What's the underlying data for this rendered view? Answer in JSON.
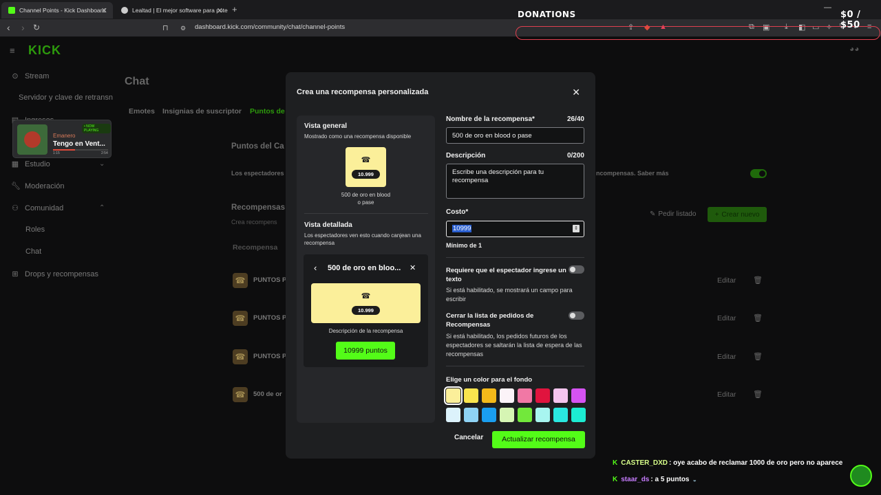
{
  "browser": {
    "tabs": [
      {
        "title": "Channel Points - Kick Dashboard",
        "active": true
      },
      {
        "title": "Lealtad | El mejor software para pote"
      }
    ],
    "new_tab": "+",
    "url": "dashboard.kick.com/community/chat/channel-points",
    "window_controls": [
      "—",
      "□",
      "✕"
    ]
  },
  "stream_overlay": {
    "donations_label": "DONATIONS",
    "donation_progress": "$0 / $50"
  },
  "sidebar": {
    "logo": "KICK",
    "items": [
      {
        "label": "Stream",
        "icon": "stream-icon"
      },
      {
        "label": "Servidor y clave de retransn"
      },
      {
        "label": "Ingresos",
        "icon": "income-icon"
      },
      {
        "label": "Estudio",
        "icon": "studio-icon"
      },
      {
        "label": "Moderación",
        "icon": "wrench-icon"
      },
      {
        "label": "Comunidad",
        "icon": "community-icon"
      },
      {
        "label": "Roles"
      },
      {
        "label": "Chat"
      },
      {
        "label": "Drops y recompensas",
        "icon": "gift-icon"
      }
    ],
    "now_playing": {
      "badge": "• NOW PLAYING",
      "artist": "Emanero",
      "song": "Tengo en Vent...",
      "time_elapsed": "1:15",
      "time_total": "2:54"
    }
  },
  "main": {
    "title": "Chat",
    "tabs": [
      "Emotes",
      "Insignias de suscriptor",
      "Puntos de"
    ],
    "section_title": "Puntos del Ca",
    "section_desc_start": "Los espectadores",
    "section_desc_end": "ncompensas. Saber más",
    "rewards_title": "Recompensas",
    "rewards_sub": "Crea recompens",
    "request_list": "Pedir listado",
    "create_new": "Crear nuevo",
    "table_header": "Recompensa",
    "rows": [
      {
        "name": "PUNTOS P",
        "action": "Editar"
      },
      {
        "name": "PUNTOS P",
        "action": "Editar"
      },
      {
        "name": "PUNTOS P",
        "action": "Editar"
      },
      {
        "name": "500 de or",
        "action": "Editar"
      }
    ]
  },
  "modal": {
    "title": "Crea una recompensa personalizada",
    "close": "✕",
    "preview": {
      "overview_title": "Vista general",
      "overview_sub": "Mostrado como una recompensa disponible",
      "cost_pill": "10.999",
      "reward_name": "500 de oro en blood o pase",
      "detail_title": "Vista detallada",
      "detail_sub": "Los espectadores ven esto cuando canjean una recompensa",
      "detail_header": "500 de oro en bloo...",
      "detail_desc": "Descripción de la recompensa",
      "detail_button": "10999 puntos"
    },
    "form": {
      "name_label": "Nombre de la recompensa*",
      "name_counter": "26/40",
      "name_value": "500 de oro en blood o pase",
      "desc_label": "Descripción",
      "desc_counter": "0/200",
      "desc_placeholder": "Escribe una descripción para tu recompensa",
      "cost_label": "Costo*",
      "cost_value": "10999",
      "cost_hint": "Mínimo de 1",
      "require_text_label": "Requiere que el espectador ingrese un texto",
      "require_text_desc": "Si está habilitado, se mostrará un campo para escribir",
      "require_text_on": false,
      "close_queue_label": "Cerrar la lista de pedidos de Recompensas",
      "close_queue_desc": "Si está habilitado, los pedidos futuros de los espectadores se saltarán la lista de espera de las recompensas",
      "close_queue_on": false,
      "color_label": "Elige un color para el fondo",
      "colors": [
        "#fbef9a",
        "#f9e44e",
        "#f4b91a",
        "#fbf3f8",
        "#f178a5",
        "#e0143e",
        "#f4c5ee",
        "#d553f2",
        "#dcf2fb",
        "#8fd3f5",
        "#1a9ef0",
        "#d6f5b4",
        "#72e83b",
        "#a8f5f0",
        "#2ae8e0",
        "#1cecd2"
      ],
      "selected_color": 0,
      "cancel": "Cancelar",
      "submit": "Actualizar recompensa"
    }
  },
  "chat_overlay": [
    {
      "user": "CASTER_DXD",
      "message": ": oye acabo de reclamar 1000 de oro pero no aparece"
    },
    {
      "user": "staar_ds",
      "message": ": a 5 puntos"
    }
  ]
}
